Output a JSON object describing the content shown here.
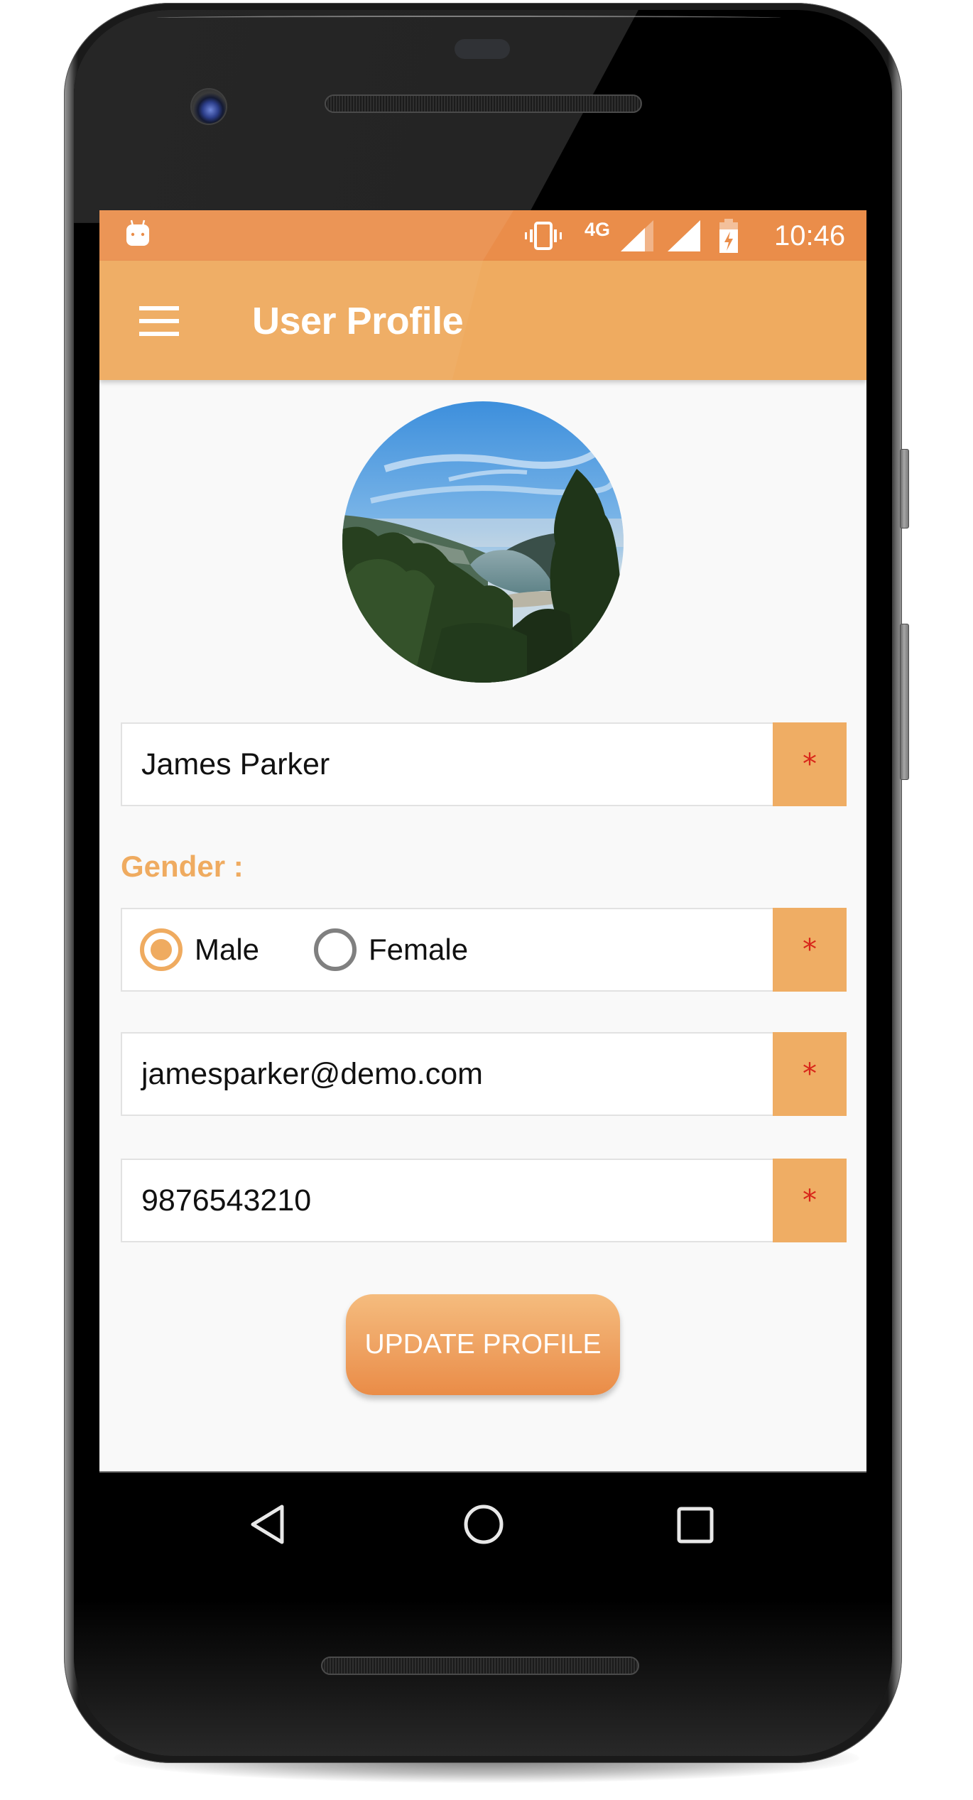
{
  "device": {
    "frame": "android-phone",
    "accent_color": "#efab60",
    "status_bar_color": "#ea8d4a",
    "required_marker_color": "#d8261a"
  },
  "status_bar": {
    "notification_icon": "android-debug-icon",
    "icons": [
      "vibrate-icon",
      "signal-4g-icon",
      "signal-strength-icon",
      "wifi-signal-icon",
      "battery-charging-icon"
    ],
    "network_label": "4G",
    "time": "10:46"
  },
  "app_bar": {
    "menu_icon": "hamburger-menu-icon",
    "title": "User Profile"
  },
  "profile": {
    "avatar_description": "Circular profile photo of a mountain lake valley with trees and blue sky"
  },
  "form": {
    "name": {
      "value": "James Parker",
      "required_marker": "*"
    },
    "gender": {
      "label": "Gender :",
      "options": [
        {
          "label": "Male",
          "checked": true
        },
        {
          "label": "Female",
          "checked": false
        }
      ],
      "required_marker": "*"
    },
    "email": {
      "value": "jamesparker@demo.com",
      "required_marker": "*"
    },
    "phone": {
      "value": "9876543210",
      "required_marker": "*"
    },
    "submit_label": "UPDATE PROFILE"
  },
  "nav_bar": {
    "buttons": [
      "back-icon",
      "home-icon",
      "recents-icon"
    ]
  }
}
